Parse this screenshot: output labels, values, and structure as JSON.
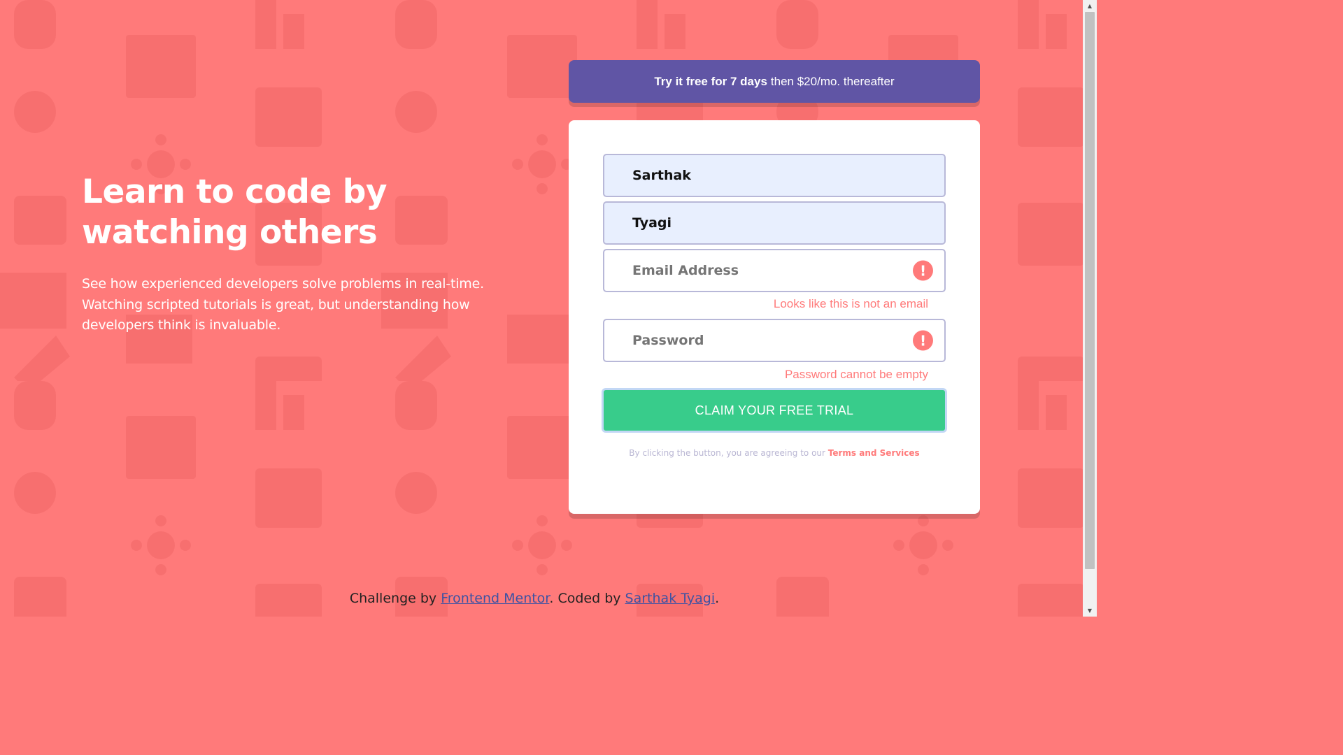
{
  "hero": {
    "title": "Learn to code by watching others",
    "description": "See how experienced developers solve problems in real-time. Watching scripted tutorials is great, but understanding how developers think is invaluable."
  },
  "promo": {
    "bold": "Try it free for 7 days",
    "rest": "then $20/mo. thereafter"
  },
  "form": {
    "first_name_value": "Sarthak",
    "last_name_value": "Tyagi",
    "email_placeholder": "Email Address",
    "email_error": "Looks like this is not an email",
    "password_placeholder": "Password",
    "password_error": "Password cannot be empty",
    "error_icon_glyph": "!",
    "submit_label": "CLAIM YOUR FREE TRIAL",
    "terms_prefix": "By clicking the button, you are agreeing to our",
    "terms_link": "Terms and Services"
  },
  "footer": {
    "prefix": "Challenge by",
    "link1": "Frontend Mentor",
    "middle": ". Coded by",
    "link2": "Sarthak Tyagi",
    "suffix": "."
  },
  "colors": {
    "background": "#ff7a7a",
    "promo": "#6055a5",
    "cta": "#38cc8b",
    "error": "#ff7a7a"
  },
  "icons": [
    "error-icon",
    "scroll-up-arrow-icon",
    "scroll-down-arrow-icon"
  ]
}
